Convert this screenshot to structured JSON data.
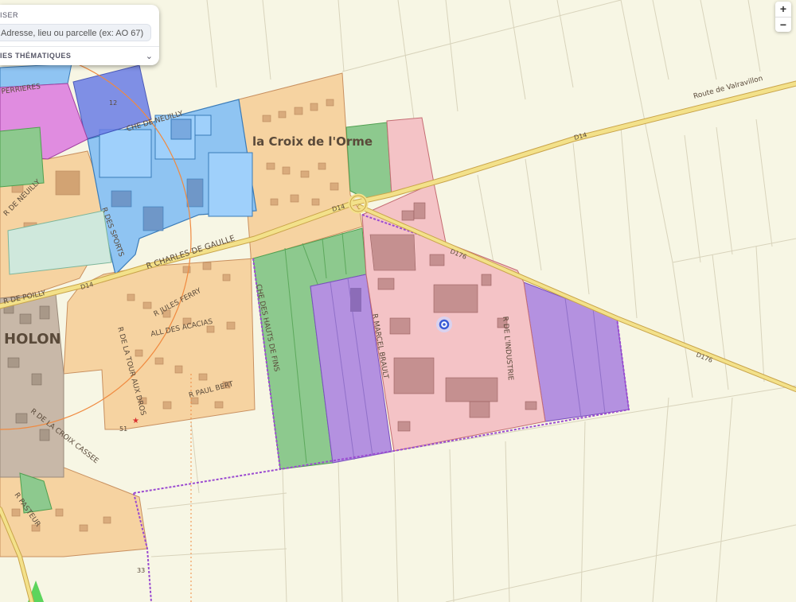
{
  "panel": {
    "header": "ISER",
    "search_text": "Adresse, lieu ou parcelle (ex: AO 67)",
    "layers_label": "IES THÉMATIQUES",
    "chevron_icon": "chevron-down-icon"
  },
  "zoom": {
    "in_label": "+",
    "out_label": "−"
  },
  "labels": {
    "place_main": "la Croix de l'Orme",
    "town": "HOLON",
    "route_valravillon": "Route de Valravillon",
    "d14_east": "D14",
    "d14_center": "D14",
    "d14_west": "D14",
    "d176_south": "D176",
    "d176_north": "D176",
    "che_neuilly": "CHE DE NEUILLY",
    "r_neuilly": "R DE NEUILLY",
    "r_sports": "R DES SPORTS",
    "r_gaulle": "R CHARLES DE GAULLE",
    "r_jules_ferry": "R JULES FERRY",
    "all_acacias": "ALL DES ACACIAS",
    "r_paul_bert": "R PAUL BERT",
    "r_tour": "R DE LA TOUR AUX DROS",
    "r_croix_cassee": "R DE LA CROIX CASSEE",
    "r_pasteur": "R PASTEUR",
    "che_hauts": "CHE DES HAUTS DE FINS",
    "r_marcel": "R MARCEL BRAULT",
    "r_industrie": "R DE L'INDUSTRIE",
    "r_perrieres": "PERRIERES",
    "r_poilly": "R DE POILLY",
    "num_12": "12",
    "num_33": "33",
    "num_51": "51"
  },
  "colors": {
    "background": "#f7f6e4",
    "urban_zone": "#f6d3a1",
    "activity_zone": "#f4c3c6",
    "equipment_zone": "#8fc4f2",
    "green_zone": "#8dc98e",
    "purple_zone": "#b491e0",
    "magenta_zone": "#e08ce0",
    "road": "#f3e18a",
    "old_town": "#c8b8a8"
  }
}
